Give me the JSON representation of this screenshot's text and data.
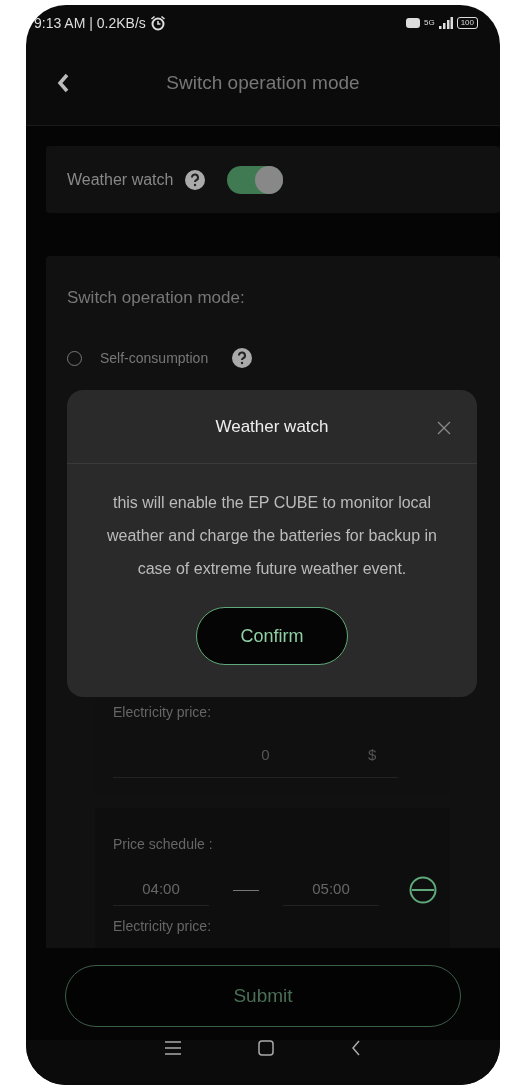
{
  "status_bar": {
    "time": "9:13 AM | 0.2KB/s",
    "network": "5G",
    "battery": "100"
  },
  "header": {
    "title": "Switch operation mode"
  },
  "weather_watch": {
    "label": "Weather watch",
    "on": true
  },
  "mode_card": {
    "title": "Switch operation mode:",
    "options": [
      {
        "label": "Self-consumption",
        "selected": false
      }
    ],
    "price_sections": [
      {
        "kind": "price",
        "label": "Electricity price:",
        "value": "0",
        "unit": "$"
      },
      {
        "kind": "schedule",
        "label": "Price schedule :",
        "start": "04:00",
        "end": "05:00",
        "sub_label": "Electricity price:"
      }
    ]
  },
  "modal": {
    "title": "Weather watch",
    "body": "this will enable the EP CUBE to monitor local weather and charge the batteries for backup in case of extreme future weather event.",
    "confirm": "Confirm"
  },
  "submit": "Submit"
}
